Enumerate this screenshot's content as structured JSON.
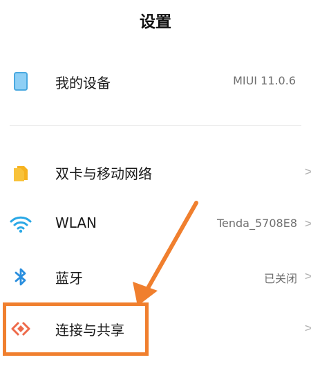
{
  "header": {
    "title": "设置"
  },
  "rows": [
    {
      "label": "我的设备",
      "value": "MIUI 11.0.6",
      "icon": "device-icon",
      "chevron": ""
    },
    {
      "label": "双卡与移动网络",
      "value": "",
      "icon": "sim-card-icon",
      "chevron": ">"
    },
    {
      "label": "WLAN",
      "value": "Tenda_5708E8",
      "icon": "wifi-icon",
      "chevron": ">"
    },
    {
      "label": "蓝牙",
      "value": "已关闭",
      "icon": "bluetooth-icon",
      "chevron": ">"
    },
    {
      "label": "连接与共享",
      "value": "",
      "icon": "connection-share-icon",
      "chevron": ">"
    }
  ],
  "colors": {
    "annotation": "#f07f2e",
    "device_icon": "#8ecff5",
    "sim_icon": "#f8c23a",
    "wifi_icon": "#2aa8e6",
    "bluetooth_icon": "#2b8fde",
    "share_icon": "#ee6a4a"
  }
}
